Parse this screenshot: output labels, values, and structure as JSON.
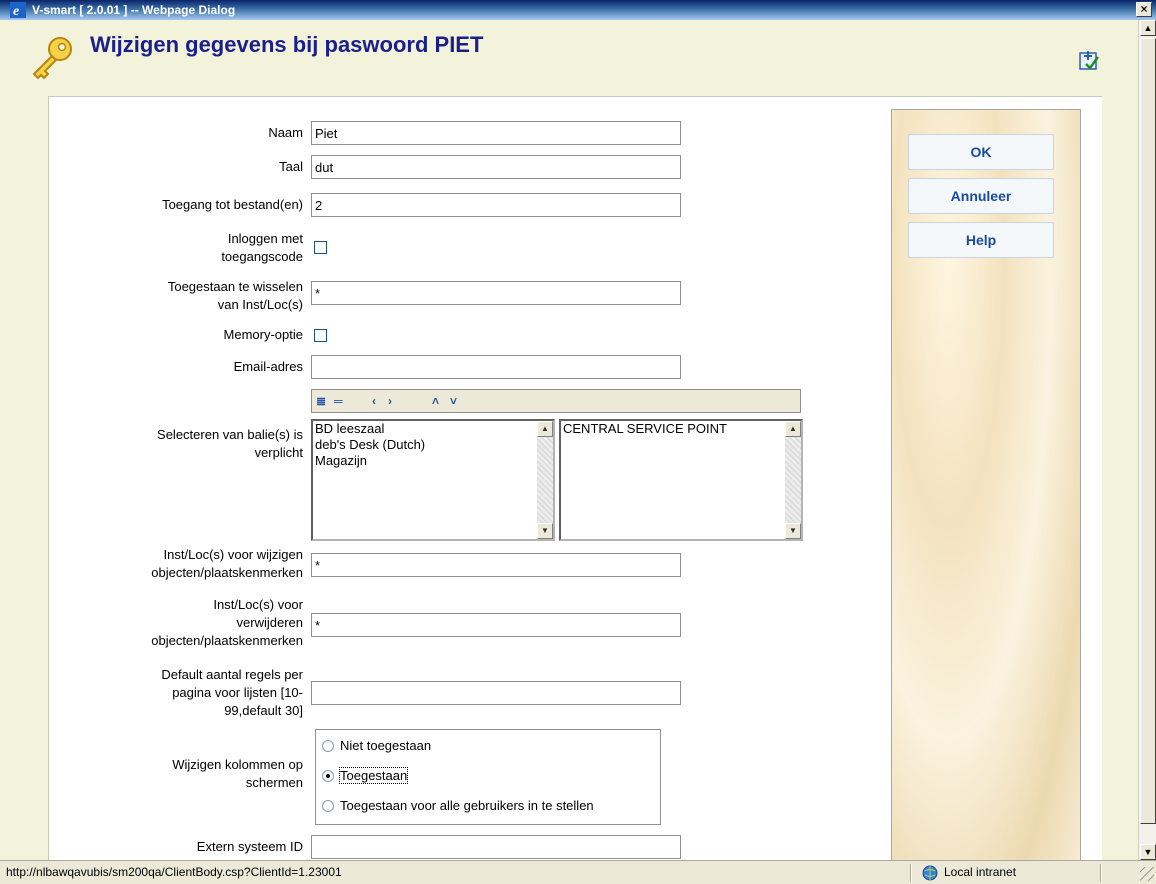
{
  "window": {
    "title": "V-smart [ 2.0.01 ] -- Webpage Dialog",
    "close_glyph": "×"
  },
  "header": {
    "title": "Wijzigen gegevens bij paswoord PIET",
    "key_icon": "key-icon",
    "tool_icon": "page-check-icon"
  },
  "form": {
    "naam": {
      "label": "Naam",
      "value": "Piet"
    },
    "taal": {
      "label": "Taal",
      "value": "dut"
    },
    "toegang": {
      "label": "Toegang tot bestand(en)",
      "value": "2"
    },
    "inloggen": {
      "label_1": "Inloggen met",
      "label_2": "toegangscode",
      "checked": false
    },
    "wisselen": {
      "label_1": "Toegestaan te wisselen",
      "label_2": "van Inst/Loc(s)",
      "value": "*"
    },
    "memory": {
      "label": "Memory-optie",
      "checked": false
    },
    "email": {
      "label": "Email-adres",
      "value": ""
    },
    "balie": {
      "label_1": "Selecteren van balie(s) is",
      "label_2": "verplicht",
      "available": [
        "BD leeszaal",
        "deb's Desk (Dutch)",
        "Magazijn"
      ],
      "selected": [
        "CENTRAL SERVICE POINT"
      ],
      "toolbar_glyphs": {
        "all": "≣",
        "none": "═",
        "left": "‹",
        "right": "›",
        "up": "˄",
        "down": "˅"
      }
    },
    "wijzigen_obj": {
      "label_1": "Inst/Loc(s) voor wijzigen",
      "label_2": "objecten/plaatskenmerken",
      "value": "*"
    },
    "verwijderen_obj": {
      "label_1": "Inst/Loc(s) voor",
      "label_2": "verwijderen",
      "label_3": "objecten/plaatskenmerken",
      "value": "*"
    },
    "regels": {
      "label_1": "Default aantal regels per",
      "label_2": "pagina voor lijsten [10-",
      "label_3": "99,default 30]",
      "value": ""
    },
    "kolommen": {
      "label_1": "Wijzigen kolommen op",
      "label_2": "schermen",
      "options": [
        "Niet toegestaan",
        "Toegestaan",
        "Toegestaan voor alle gebruikers in te stellen"
      ],
      "selected": "Toegestaan"
    },
    "extern": {
      "label": "Extern systeem ID",
      "value": ""
    }
  },
  "side": {
    "ok": "OK",
    "annuleer": "Annuleer",
    "help": "Help"
  },
  "scroll": {
    "up": "▲",
    "down": "▼"
  },
  "status": {
    "url": "http://nlbawqavubis/sm200qa/ClientBody.csp?ClientId=1.23001",
    "zone": "Local intranet"
  },
  "colors": {
    "title_blue": "#1a1f8a",
    "button_text": "#1a4aa0",
    "page_bg": "#f3f3dc"
  }
}
